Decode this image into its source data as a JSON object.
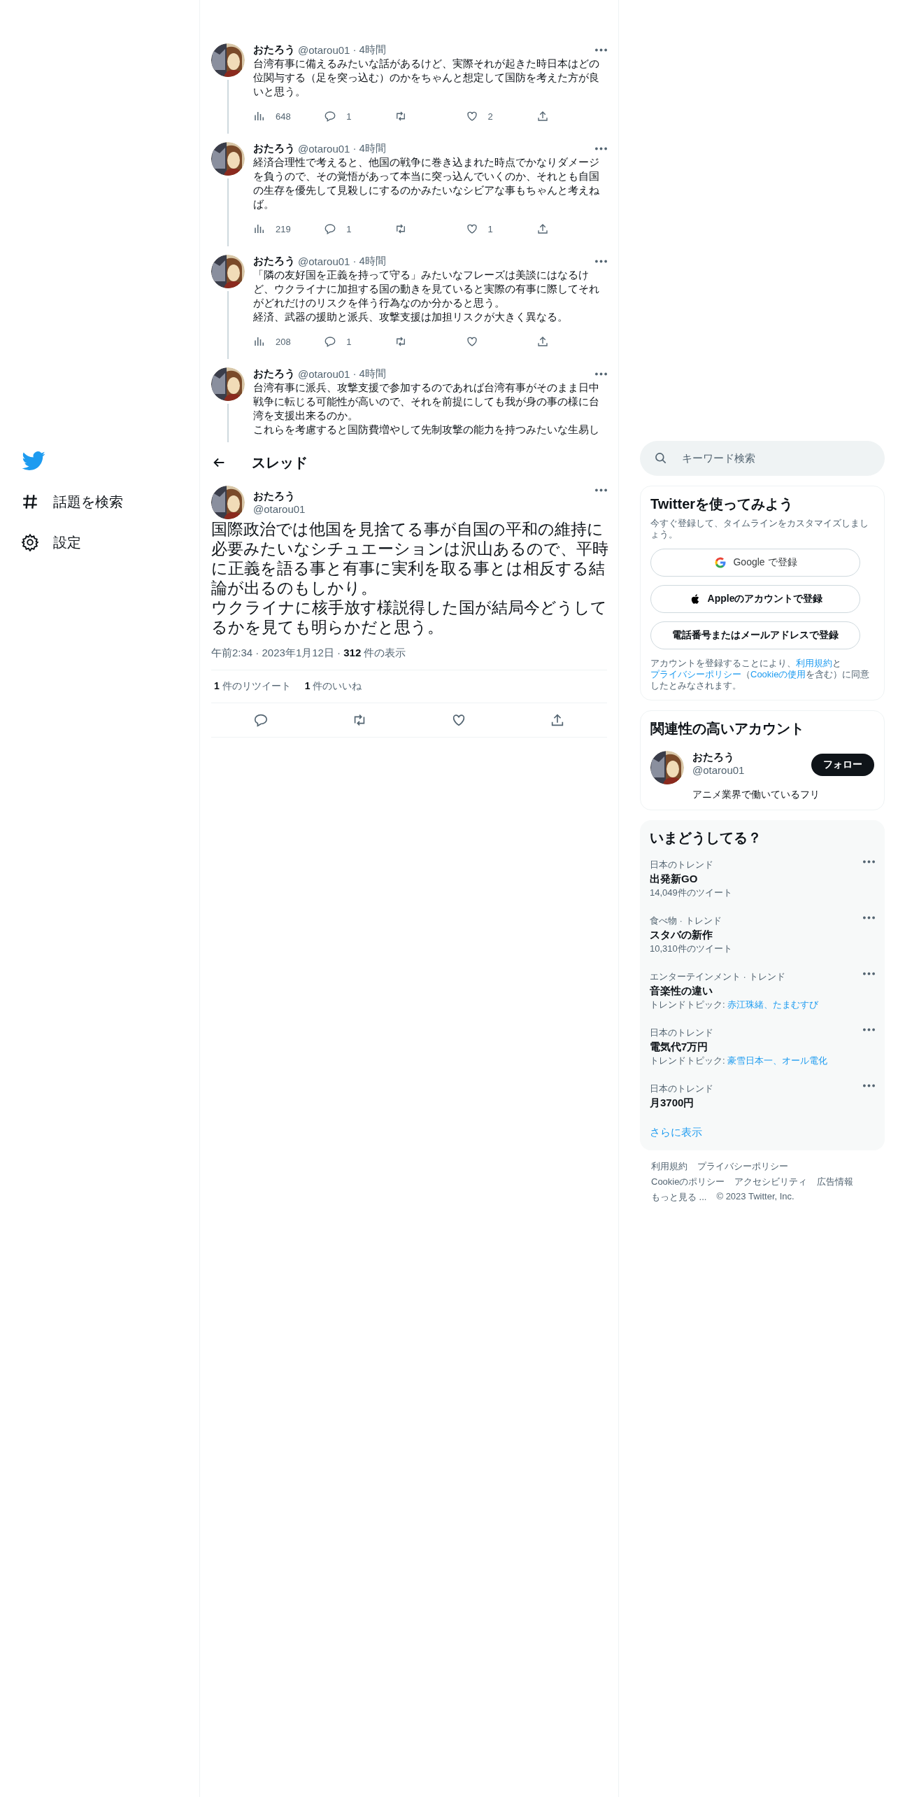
{
  "nav": {
    "items": [
      {
        "kind": "logo"
      },
      {
        "kind": "hash",
        "label": "話題を検索"
      },
      {
        "kind": "gear",
        "label": "設定"
      }
    ]
  },
  "thread": [
    {
      "name": "おたろう",
      "handle": "@otarou01",
      "time": "· 4時間",
      "text": [
        "台湾有事に備えるみたいな話があるけど、実際それが起きた時日本はどの位関与する（足を突っ込む）のかをちゃんと想定して国防を考えた方が良いと思う。"
      ],
      "views": "648",
      "replies": "1",
      "likes": "2"
    },
    {
      "name": "おたろう",
      "handle": "@otarou01",
      "time": "· 4時間",
      "text": [
        "経済合理性で考えると、他国の戦争に巻き込まれた時点でかなりダメージを負うので、その覚悟があって本当に突っ込んでいくのか、それとも自国の生存を優先して見殺しにするのかみたいなシビアな事もちゃんと考えねば。"
      ],
      "views": "219",
      "replies": "1",
      "likes": "1"
    },
    {
      "name": "おたろう",
      "handle": "@otarou01",
      "time": "· 4時間",
      "text": [
        "「隣の友好国を正義を持って守る」みたいなフレーズは美談にはなるけど、ウクライナに加担する国の動きを見ていると実際の有事に際してそれがどれだけのリスクを伴う行為なのか分かると思う。",
        "経済、武器の援助と派兵、攻撃支援は加担リスクが大きく異なる。"
      ],
      "views": "208",
      "replies": "1"
    },
    {
      "name": "おたろう",
      "handle": "@otarou01",
      "time": "· 4時間",
      "text": [
        "台湾有事に派兵、攻撃支援で参加するのであれば台湾有事がそのまま日中戦争に転じる可能性が高いので、それを前提にしても我が身の事の様に台湾を支援出来るのか。",
        "これらを考慮すると国防費増やして先制攻撃の能力を持つみたいな生易し"
      ]
    }
  ],
  "header": {
    "title": "スレッド"
  },
  "focus": {
    "name": "おたろう",
    "handle": "@otarou01",
    "text": [
      "国際政治では他国を見捨てる事が自国の平和の維持に必要みたいなシチュエーションは沢山あるので、平時に正義を語る事と有事に実利を取る事とは相反する結論が出るのもしかり。",
      "ウクライナに核手放す様説得した国が結局今どうしてるかを見ても明らかだと思う。"
    ],
    "meta": "午前2:34 · 2023年1月12日 · **312** 件の表示",
    "stats": [
      {
        "count": "1",
        "label": "件のリツイート"
      },
      {
        "count": "1",
        "label": "件のいいね"
      }
    ]
  },
  "search": {
    "placeholder": "キーワード検索"
  },
  "signup": {
    "title": "Twitterを使ってみよう",
    "subtitle": "今すぐ登録して、タイムラインをカスタマイズしましょう。",
    "buttons": [
      {
        "kind": "google",
        "label": "Google で登録"
      },
      {
        "kind": "apple",
        "label": "Appleのアカウントで登録"
      },
      {
        "kind": "plain",
        "label": "電話番号またはメールアドレスで登録"
      }
    ],
    "legal": [
      {
        "text": "アカウントを登録することにより、",
        "link": false
      },
      {
        "text": "利用規約",
        "link": true
      },
      {
        "text": "と",
        "link": false
      },
      {
        "text": "プライバシーポリシー",
        "link": true
      },
      {
        "text": "（",
        "link": false
      },
      {
        "text": "Cookieの使用",
        "link": true
      },
      {
        "text": "を含む）に同意したとみなされます。",
        "link": false
      }
    ]
  },
  "accounts": {
    "title": "関連性の高いアカウント",
    "items": [
      {
        "name": "おたろう",
        "handle": "@otarou01",
        "bio": "アニメ業界で働いているフリ",
        "button": "フォロー"
      }
    ]
  },
  "trends": {
    "title": "いまどうしてる？",
    "items": [
      {
        "context": "日本のトレンド",
        "title": "出発新GO",
        "tweets": "14,049件のツイート"
      },
      {
        "context": "食べ物 · トレンド",
        "title": "スタバの新作",
        "tweets": "10,310件のツイート"
      },
      {
        "context": "エンターテインメント · トレンド",
        "title": "音楽性の違い",
        "topic_label": "トレンドトピック:",
        "topics": "赤江珠緒、たまむすび"
      },
      {
        "context": "日本のトレンド",
        "title": "電気代7万円",
        "topic_label": "トレンドトピック:",
        "topics": "豪雪日本一、オール電化"
      },
      {
        "context": "日本のトレンド",
        "title": "月3700円"
      }
    ],
    "more": "さらに表示"
  },
  "footer": {
    "links": [
      "利用規約",
      "プライバシーポリシー",
      "Cookieのポリシー",
      "アクセシビリティ",
      "広告情報",
      "もっと見る ..."
    ],
    "copyright": "© 2023 Twitter, Inc."
  }
}
